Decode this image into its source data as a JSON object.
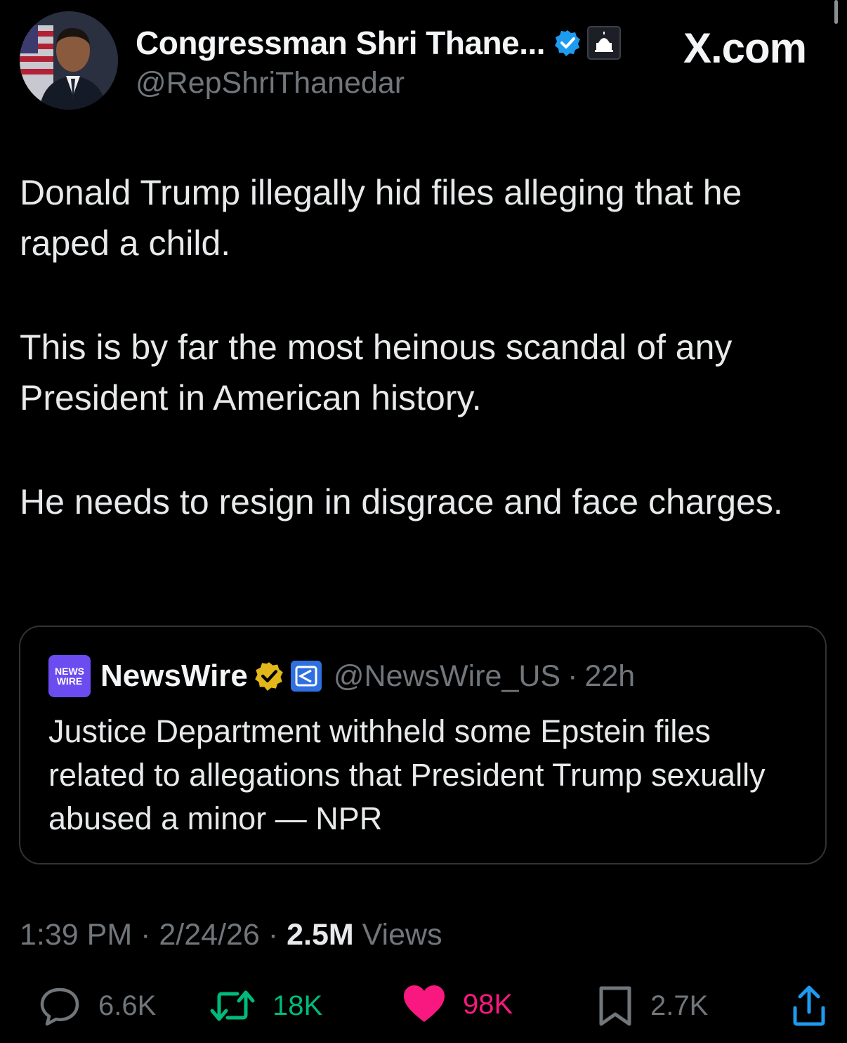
{
  "author": {
    "display_name": "Congressman Shri Thane...",
    "handle": "@RepShriThanedar",
    "verified_icon": "verified-blue-check-icon",
    "affiliation_icon": "us-capitol-badge-icon"
  },
  "brand": "X.com",
  "tweet": {
    "paragraphs": [
      "Donald Trump illegally hid files alleging that he raped a child.",
      "This is by far the most heinous scandal of any President in American history.",
      "He needs to resign in disgrace and face charges."
    ]
  },
  "quote": {
    "logo_lines": [
      "NEWS",
      "WIRE"
    ],
    "name": "NewsWire",
    "handle": "@NewsWire_US",
    "separator": "·",
    "time": "22h",
    "text": "Justice Department withheld some Epstein files related to allegations that President Trump sexually abused a minor — NPR"
  },
  "meta": {
    "time": "1:39 PM",
    "date": "2/24/26",
    "separator": "·",
    "views_count": "2.5M",
    "views_label": "Views"
  },
  "actions": {
    "reply_count": "6.6K",
    "retweet_count": "18K",
    "like_count": "98K",
    "bookmark_count": "2.7K"
  },
  "colors": {
    "background": "#000000",
    "text": "#e7e9ea",
    "muted": "#71767b",
    "retweet": "#00ba7c",
    "like": "#f91880",
    "verified": "#1d9bf0",
    "gold_badge": "#e2b719"
  }
}
